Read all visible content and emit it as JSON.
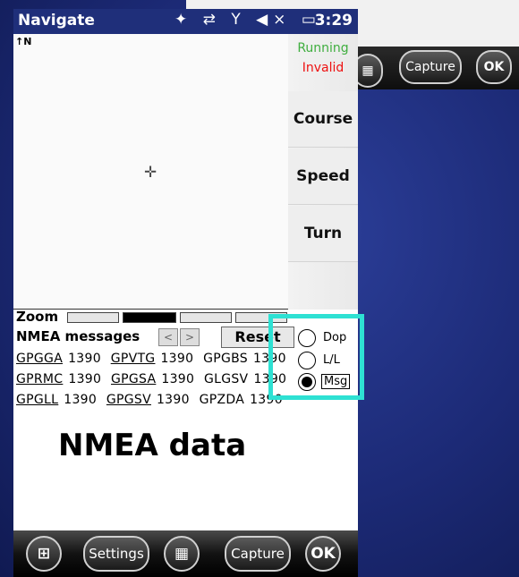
{
  "status_bar": {
    "title": "Navigate",
    "icons": [
      "satellite-icon",
      "sync-icon",
      "signal-off-icon",
      "mute-icon",
      "battery-icon"
    ],
    "time": "3:29"
  },
  "map": {
    "north_label": "↑N",
    "cross_symbol": "✛"
  },
  "side_panel": {
    "running": "Running",
    "invalid": "Invalid",
    "buttons": [
      "Course",
      "Speed",
      "Turn"
    ]
  },
  "zoom": {
    "label": "Zoom",
    "segments": 4,
    "active_segment": 2
  },
  "nmea": {
    "title": "NMEA messages",
    "prev_label": "<",
    "next_label": ">",
    "reset_label": "Reset",
    "rows": [
      [
        {
          "name": "GPGGA",
          "count": "1390"
        },
        {
          "name": "GPVTG",
          "count": "1390"
        },
        {
          "name": "GPGBS",
          "count": "1390"
        }
      ],
      [
        {
          "name": "GPRMC",
          "count": "1390"
        },
        {
          "name": "GPGSA",
          "count": "1390"
        },
        {
          "name": "GLGSV",
          "count": "1390"
        }
      ],
      [
        {
          "name": "GPGLL",
          "count": "1390"
        },
        {
          "name": "GPGSV",
          "count": "1390"
        },
        {
          "name": "GPZDA",
          "count": "1390"
        }
      ]
    ]
  },
  "radio": {
    "options": [
      "Dop",
      "L/L",
      "Msg"
    ],
    "selected": "Msg"
  },
  "annotation": {
    "label": "NMEA data"
  },
  "bottom_bar": {
    "settings_label": "Settings",
    "capture_label": "Capture",
    "ok_label": "OK"
  },
  "background_window": {
    "capture_label": "Capture",
    "ok_label": "OK"
  },
  "colors": {
    "status_blue": "#1f2f7a",
    "running_green": "#3fae3f",
    "invalid_red": "#e11111",
    "highlight_cyan": "#2ee1d3"
  }
}
